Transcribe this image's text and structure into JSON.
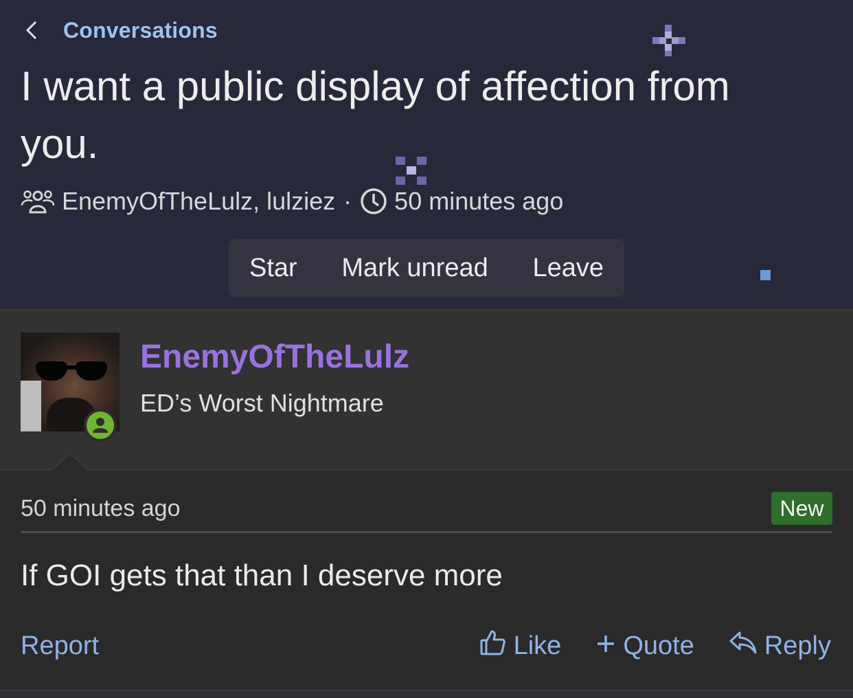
{
  "nav": {
    "back_label": "Conversations"
  },
  "conversation": {
    "title": "I want a public display of affection from you.",
    "participants": "EnemyOfTheLulz, lulziez",
    "separator": "·",
    "time": "50 minutes ago"
  },
  "actions": {
    "star": "Star",
    "mark_unread": "Mark unread",
    "leave": "Leave"
  },
  "author": {
    "name": "EnemyOfTheLulz",
    "title": "ED’s Worst Nightmare"
  },
  "message": {
    "time": "50 minutes ago",
    "badge": "New",
    "body": "If GOI gets that than I deserve more",
    "report": "Report",
    "like": "Like",
    "quote": "Quote",
    "reply": "Reply"
  },
  "colors": {
    "header_bg": "#27283a",
    "link": "#9cc3ef",
    "username": "#9a72e0",
    "online": "#6fb631",
    "new_badge": "#2f6e2c"
  },
  "icons": [
    "chevron-left-icon",
    "users-icon",
    "clock-icon",
    "user-online-icon",
    "thumbs-up-icon",
    "plus-icon",
    "reply-icon"
  ]
}
